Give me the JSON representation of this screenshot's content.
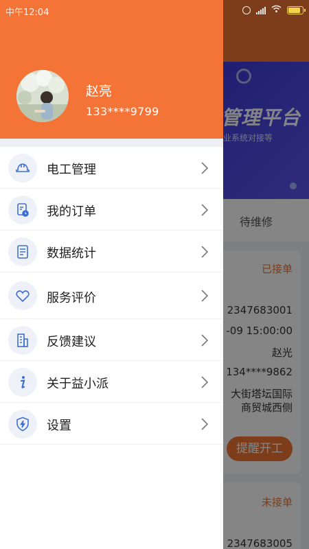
{
  "status_bar": {
    "time": "中午12:04",
    "battery_level": 0.75
  },
  "colors": {
    "accent": "#f47438",
    "banner": "#2b35c9"
  },
  "background_page": {
    "banner_title": "管理平台",
    "banner_subtitle": "业系统对接等",
    "tab_visible": "待维修",
    "order_1": {
      "status": "已接单",
      "order_no": "2347683001",
      "time": "-09 15:00:00",
      "name": "赵光",
      "phone": "134****9862",
      "address_line1": "大街塔坛国际",
      "address_line2": "商贸城西侧",
      "remind_button": "提醒开工"
    },
    "order_2": {
      "status": "未接单",
      "order_no": "2347683005"
    }
  },
  "drawer": {
    "user": {
      "name": "赵亮",
      "phone": "133****9799"
    },
    "menu": [
      {
        "label": "电工管理",
        "icon": "helmet-icon"
      },
      {
        "label": "我的订单",
        "icon": "order-list-icon"
      },
      {
        "label": "数据统计",
        "icon": "document-stats-icon"
      },
      {
        "label": "服务评价",
        "icon": "heart-icon"
      },
      {
        "label": "反馈建议",
        "icon": "building-feedback-icon"
      },
      {
        "label": "关于益小派",
        "icon": "info-icon"
      },
      {
        "label": "设置",
        "icon": "shield-bolt-icon"
      }
    ]
  }
}
